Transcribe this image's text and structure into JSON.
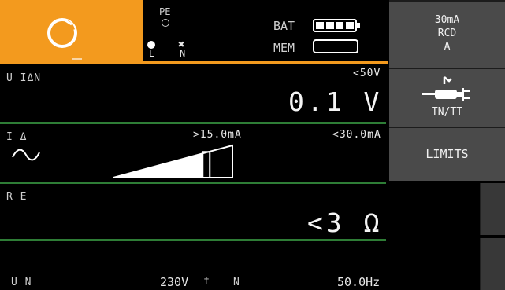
{
  "header": {
    "pe_label": "PE",
    "l_label": "L",
    "n_label": "N",
    "bat_label": "BAT",
    "mem_label": "MEM",
    "battery_level": 1.0
  },
  "rows": {
    "u_idn": {
      "label": "U IΔN",
      "limit": "<50V",
      "value": "0.1 V"
    },
    "i_delta": {
      "label": "I Δ",
      "low": ">15.0mA",
      "high": "<30.0mA",
      "ramp_position": 0.75
    },
    "re": {
      "label": "R E",
      "value": "<3 Ω"
    },
    "un": {
      "label": "U N",
      "voltage": "230V",
      "f_label": "f",
      "n_label": "N",
      "frequency": "50.0Hz"
    }
  },
  "sidebar": {
    "rcd": {
      "line1": "30mA",
      "line2": "RCD",
      "line3": "A"
    },
    "network": {
      "label": "TN/TT"
    },
    "limits": {
      "label": "LIMITS"
    }
  },
  "colors": {
    "accent": "#f39a1e",
    "line": "#2e7d36",
    "button": "#4a4a4a"
  }
}
